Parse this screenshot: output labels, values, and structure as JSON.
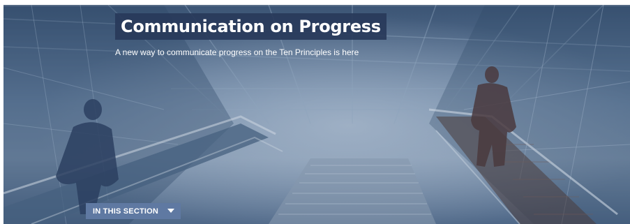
{
  "hero": {
    "title": "Communication on Progress",
    "subtitle": "A new way to communicate progress on the Ten Principles is here",
    "background_image": "escalators-people-silhouette-photo",
    "overlay_color": "#3e5675"
  },
  "section_nav": {
    "label": "IN THIS SECTION",
    "icon": "caret-down-icon",
    "color": "#5f79a2"
  }
}
